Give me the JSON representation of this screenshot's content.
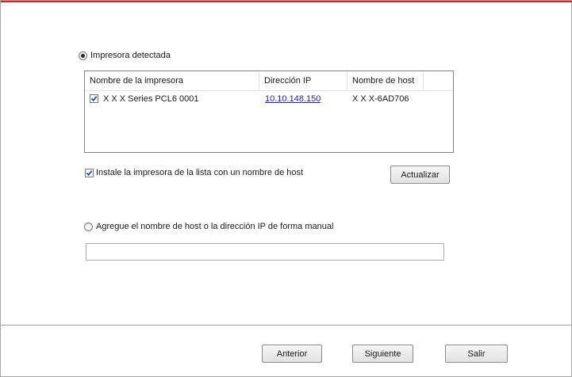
{
  "colors": {
    "accent": "#d0202e",
    "link": "#1f1f9f"
  },
  "detected": {
    "radio_label": "Impresora detectada",
    "selected": true,
    "columns": [
      "Nombre de la impresora",
      "Dirección IP",
      "Nombre de host"
    ],
    "rows": [
      {
        "checked": true,
        "name": "X X X  Series PCL6 0001",
        "ip": "10.10.148.150",
        "host": "X X X-6AD706"
      }
    ],
    "install_checkbox_label": "Instale la impresora de la lista con un nombre de host",
    "install_checked": true,
    "refresh_label": "Actualizar"
  },
  "manual": {
    "radio_label": "Agregue el nombre de host o la dirección IP de forma manual",
    "selected": false,
    "input_value": ""
  },
  "footer": {
    "back_label": "Anterior",
    "next_label": "Siguiente",
    "exit_label": "Salir"
  }
}
